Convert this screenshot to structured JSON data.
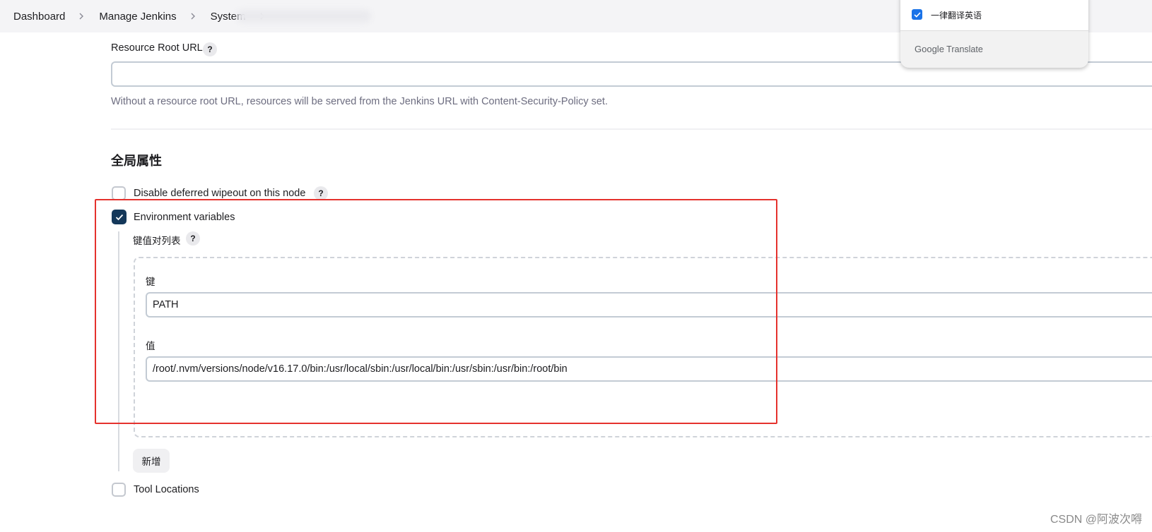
{
  "breadcrumb": {
    "items": [
      "Dashboard",
      "Manage Jenkins",
      "System"
    ]
  },
  "resource_root": {
    "label": "Resource Root URL",
    "help": "?",
    "value": "",
    "hint": "Without a resource root URL, resources will be served from the Jenkins URL with Content-Security-Policy set."
  },
  "global_properties": {
    "title": "全局属性",
    "disable_wipeout": {
      "label": "Disable deferred wipeout on this node",
      "checked": false,
      "help": "?"
    },
    "env_vars": {
      "label": "Environment variables",
      "checked": true
    },
    "kv_list": {
      "label": "键值对列表",
      "help": "?",
      "key_label": "键",
      "key_value": "PATH",
      "value_label": "值",
      "value_value": "/root/.nvm/versions/node/v16.17.0/bin:/usr/local/sbin:/usr/local/bin:/usr/sbin:/usr/bin:/root/bin",
      "add_label": "新增"
    },
    "tool_locations": {
      "label": "Tool Locations",
      "checked": false
    }
  },
  "translate_popup": {
    "option_label": "一律翻译英语",
    "option_checked": true,
    "brand_google": "Google",
    "brand_translate": "Translate"
  },
  "watermark": "CSDN @阿波次嘚",
  "colors": {
    "checkbox_checked": "#14385a",
    "highlight_box": "#e5322d",
    "translate_check": "#1a73e8"
  }
}
